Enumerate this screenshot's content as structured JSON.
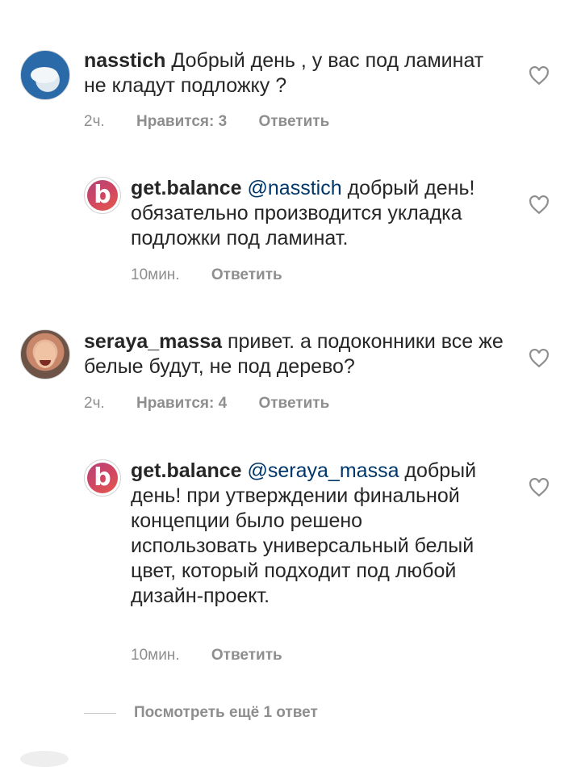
{
  "comments": [
    {
      "username": "nasstich",
      "text": "Добрый день , у вас под ламинат не кладут подложку ?",
      "time": "2ч.",
      "likes": "Нравится: 3",
      "reply": "Ответить"
    },
    {
      "username": "get.balance",
      "mention": "@nasstich",
      "text": "добрый день! обязательно производится укладка подложки под ламинат.",
      "time": "10мин.",
      "reply": "Ответить"
    },
    {
      "username": "seraya_massa",
      "text": "привет. а подоконники все же белые будут, не под дерево?",
      "time": "2ч.",
      "likes": "Нравится: 4",
      "reply": "Ответить"
    },
    {
      "username": "get.balance",
      "mention": "@seraya_massa",
      "text": "добрый день! при утверждении финальной концепции было решено использовать универсальный белый цвет, который подходит под любой дизайн-проект.",
      "time": "10мин.",
      "reply": "Ответить"
    }
  ],
  "view_more": "Посмотреть ещё 1 ответ",
  "brand_avatar_letter": "b",
  "colors": {
    "mention": "#00376b",
    "secondary": "#8e8e8e",
    "text": "#262626"
  },
  "icons": {
    "like": "heart-outline-icon"
  }
}
